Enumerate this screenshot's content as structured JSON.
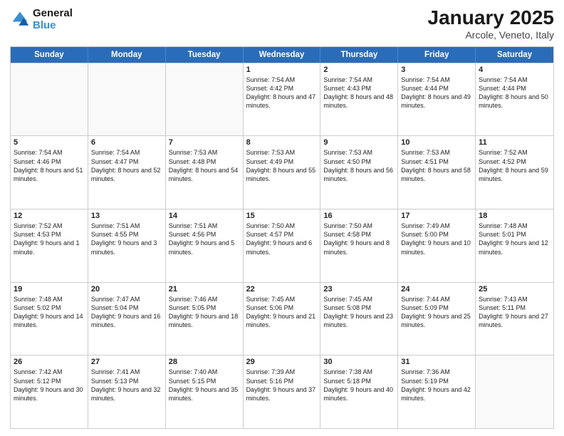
{
  "logo": {
    "line1": "General",
    "line2": "Blue"
  },
  "title": "January 2025",
  "location": "Arcole, Veneto, Italy",
  "days_header": [
    "Sunday",
    "Monday",
    "Tuesday",
    "Wednesday",
    "Thursday",
    "Friday",
    "Saturday"
  ],
  "weeks": [
    [
      {
        "num": "",
        "text": ""
      },
      {
        "num": "",
        "text": ""
      },
      {
        "num": "",
        "text": ""
      },
      {
        "num": "1",
        "text": "Sunrise: 7:54 AM\nSunset: 4:42 PM\nDaylight: 8 hours and 47 minutes."
      },
      {
        "num": "2",
        "text": "Sunrise: 7:54 AM\nSunset: 4:43 PM\nDaylight: 8 hours and 48 minutes."
      },
      {
        "num": "3",
        "text": "Sunrise: 7:54 AM\nSunset: 4:44 PM\nDaylight: 8 hours and 49 minutes."
      },
      {
        "num": "4",
        "text": "Sunrise: 7:54 AM\nSunset: 4:44 PM\nDaylight: 8 hours and 50 minutes."
      }
    ],
    [
      {
        "num": "5",
        "text": "Sunrise: 7:54 AM\nSunset: 4:46 PM\nDaylight: 8 hours and 51 minutes."
      },
      {
        "num": "6",
        "text": "Sunrise: 7:54 AM\nSunset: 4:47 PM\nDaylight: 8 hours and 52 minutes."
      },
      {
        "num": "7",
        "text": "Sunrise: 7:53 AM\nSunset: 4:48 PM\nDaylight: 8 hours and 54 minutes."
      },
      {
        "num": "8",
        "text": "Sunrise: 7:53 AM\nSunset: 4:49 PM\nDaylight: 8 hours and 55 minutes."
      },
      {
        "num": "9",
        "text": "Sunrise: 7:53 AM\nSunset: 4:50 PM\nDaylight: 8 hours and 56 minutes."
      },
      {
        "num": "10",
        "text": "Sunrise: 7:53 AM\nSunset: 4:51 PM\nDaylight: 8 hours and 58 minutes."
      },
      {
        "num": "11",
        "text": "Sunrise: 7:52 AM\nSunset: 4:52 PM\nDaylight: 8 hours and 59 minutes."
      }
    ],
    [
      {
        "num": "12",
        "text": "Sunrise: 7:52 AM\nSunset: 4:53 PM\nDaylight: 9 hours and 1 minute."
      },
      {
        "num": "13",
        "text": "Sunrise: 7:51 AM\nSunset: 4:55 PM\nDaylight: 9 hours and 3 minutes."
      },
      {
        "num": "14",
        "text": "Sunrise: 7:51 AM\nSunset: 4:56 PM\nDaylight: 9 hours and 5 minutes."
      },
      {
        "num": "15",
        "text": "Sunrise: 7:50 AM\nSunset: 4:57 PM\nDaylight: 9 hours and 6 minutes."
      },
      {
        "num": "16",
        "text": "Sunrise: 7:50 AM\nSunset: 4:58 PM\nDaylight: 9 hours and 8 minutes."
      },
      {
        "num": "17",
        "text": "Sunrise: 7:49 AM\nSunset: 5:00 PM\nDaylight: 9 hours and 10 minutes."
      },
      {
        "num": "18",
        "text": "Sunrise: 7:48 AM\nSunset: 5:01 PM\nDaylight: 9 hours and 12 minutes."
      }
    ],
    [
      {
        "num": "19",
        "text": "Sunrise: 7:48 AM\nSunset: 5:02 PM\nDaylight: 9 hours and 14 minutes."
      },
      {
        "num": "20",
        "text": "Sunrise: 7:47 AM\nSunset: 5:04 PM\nDaylight: 9 hours and 16 minutes."
      },
      {
        "num": "21",
        "text": "Sunrise: 7:46 AM\nSunset: 5:05 PM\nDaylight: 9 hours and 18 minutes."
      },
      {
        "num": "22",
        "text": "Sunrise: 7:45 AM\nSunset: 5:06 PM\nDaylight: 9 hours and 21 minutes."
      },
      {
        "num": "23",
        "text": "Sunrise: 7:45 AM\nSunset: 5:08 PM\nDaylight: 9 hours and 23 minutes."
      },
      {
        "num": "24",
        "text": "Sunrise: 7:44 AM\nSunset: 5:09 PM\nDaylight: 9 hours and 25 minutes."
      },
      {
        "num": "25",
        "text": "Sunrise: 7:43 AM\nSunset: 5:11 PM\nDaylight: 9 hours and 27 minutes."
      }
    ],
    [
      {
        "num": "26",
        "text": "Sunrise: 7:42 AM\nSunset: 5:12 PM\nDaylight: 9 hours and 30 minutes."
      },
      {
        "num": "27",
        "text": "Sunrise: 7:41 AM\nSunset: 5:13 PM\nDaylight: 9 hours and 32 minutes."
      },
      {
        "num": "28",
        "text": "Sunrise: 7:40 AM\nSunset: 5:15 PM\nDaylight: 9 hours and 35 minutes."
      },
      {
        "num": "29",
        "text": "Sunrise: 7:39 AM\nSunset: 5:16 PM\nDaylight: 9 hours and 37 minutes."
      },
      {
        "num": "30",
        "text": "Sunrise: 7:38 AM\nSunset: 5:18 PM\nDaylight: 9 hours and 40 minutes."
      },
      {
        "num": "31",
        "text": "Sunrise: 7:36 AM\nSunset: 5:19 PM\nDaylight: 9 hours and 42 minutes."
      },
      {
        "num": "",
        "text": ""
      }
    ]
  ]
}
